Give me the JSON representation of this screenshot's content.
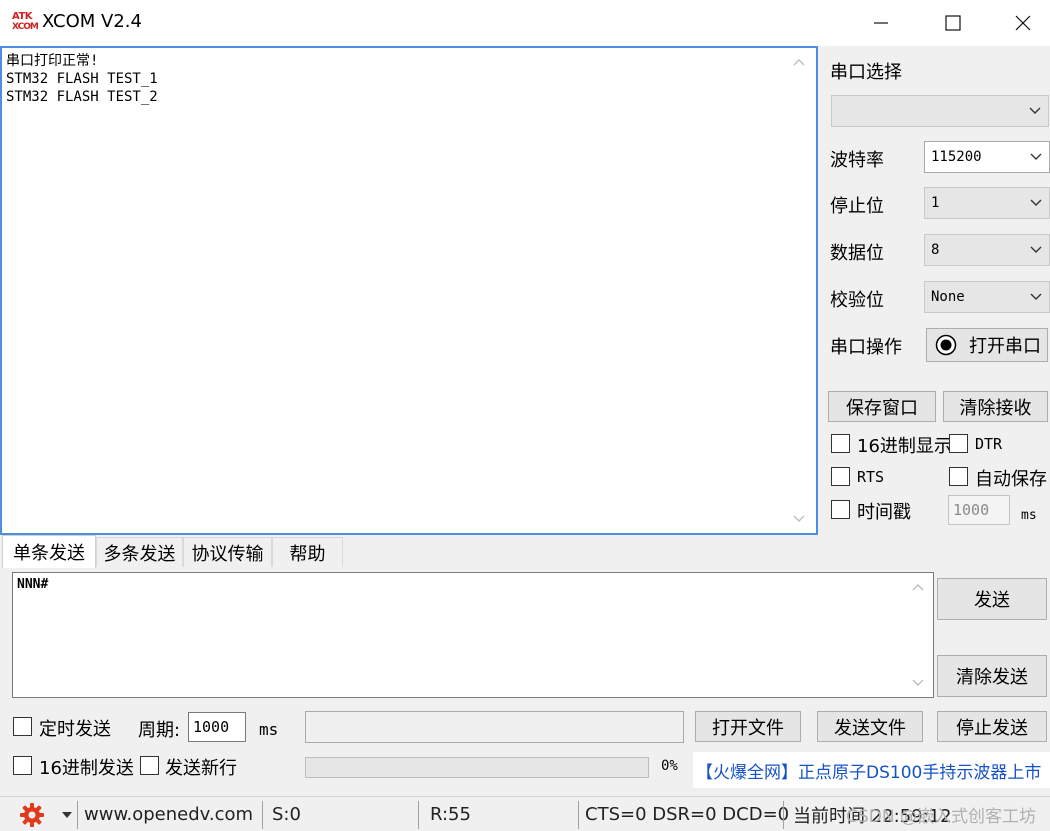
{
  "window": {
    "logo_line1": "ATK",
    "logo_line2": "XCOM",
    "title": "XCOM V2.4",
    "minimize": "—",
    "maximize": "☐",
    "close": "✕"
  },
  "receive": {
    "lines": "串口打印正常!\nSTM32 FLASH TEST_1\nSTM32 FLASH TEST_2"
  },
  "panel": {
    "port_select_label": "串口选择",
    "port_value": "",
    "baud_label": "波特率",
    "baud_value": "115200",
    "stopbits_label": "停止位",
    "stopbits_value": "1",
    "databits_label": "数据位",
    "databits_value": "8",
    "parity_label": "校验位",
    "parity_value": "None",
    "port_op_label": "串口操作",
    "open_port_button": "打开串口",
    "save_window_button": "保存窗口",
    "clear_receive_button": "清除接收",
    "hex_display_label": "16进制显示",
    "dtr_label": "DTR",
    "rts_label": "RTS",
    "auto_save_label": "自动保存",
    "timestamp_label": "时间戳",
    "timestamp_value": "1000",
    "timestamp_unit": "ms"
  },
  "tabs": [
    "单条发送",
    "多条发送",
    "协议传输",
    "帮助"
  ],
  "send": {
    "text": "NNN#",
    "send_button": "发送",
    "clear_send_button": "清除发送",
    "timed_send_label": "定时发送",
    "period_label": "周期:",
    "period_value": "1000",
    "period_unit": "ms",
    "open_file_button": "打开文件",
    "send_file_button": "发送文件",
    "stop_send_button": "停止发送",
    "hex_send_label": "16进制发送",
    "send_newline_label": "发送新行",
    "progress_percent": "0%",
    "progress_fraction": 0
  },
  "promo": "【火爆全网】正点原子DS100手持示波器上市",
  "status": {
    "url": "www.openedv.com",
    "sent": "S:0",
    "received": "R:55",
    "lines": "CTS=0 DSR=0 DCD=0",
    "time": "当前时间 22:59:12",
    "watermark": "CSDN @嵌入式创客工坊"
  },
  "colors": {
    "accent_border": "#4a8fe0",
    "promo_text": "#1452c8",
    "gear_icon": "#e03a1e"
  }
}
